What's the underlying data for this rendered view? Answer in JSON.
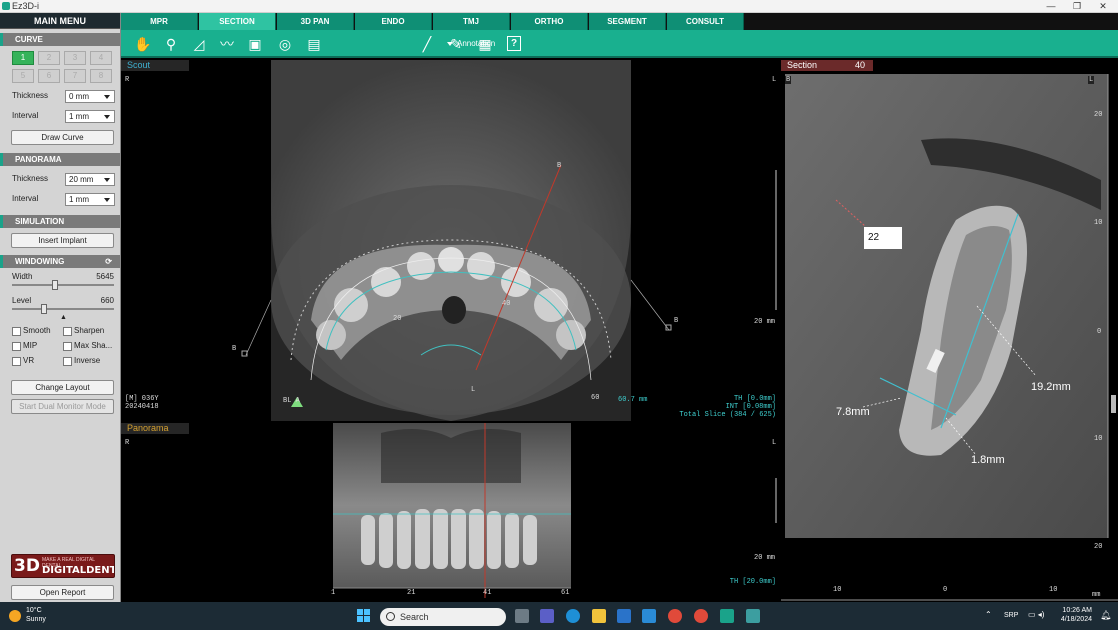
{
  "window": {
    "title": "Ez3D-i",
    "controls": [
      "—",
      "❐",
      "✕"
    ]
  },
  "sidebar": {
    "main_menu": "MAIN MENU",
    "curve": {
      "header": "CURVE",
      "numbers": [
        "1",
        "2",
        "3",
        "4",
        "5",
        "6",
        "7",
        "8"
      ],
      "thickness_label": "Thickness",
      "thickness_value": "0 mm",
      "interval_label": "Interval",
      "interval_value": "1 mm",
      "draw_curve": "Draw Curve"
    },
    "panorama": {
      "header": "PANORAMA",
      "thickness_label": "Thickness",
      "thickness_value": "20 mm",
      "interval_label": "Interval",
      "interval_value": "1 mm"
    },
    "simulation": {
      "header": "SIMULATION",
      "insert_implant": "Insert Implant"
    },
    "windowing": {
      "header": "WINDOWING",
      "width_label": "Width",
      "width_value": "5645",
      "width_fraction": 0.42,
      "level_label": "Level",
      "level_value": "660",
      "level_fraction": 0.31,
      "checks": [
        "Smooth",
        "Sharpen",
        "MIP",
        "Max Sha...",
        "VR",
        "Inverse"
      ]
    },
    "change_layout": "Change Layout",
    "dual_monitor": "Start Dual Monitor Mode",
    "logo": {
      "big": "3D",
      "small": "DIGITALDENT",
      "tiny": "MAKE A REAL DIGITAL DENTAL"
    },
    "open_report": "Open Report"
  },
  "tabs": [
    "MPR",
    "SECTION",
    "3D PAN",
    "ENDO",
    "TMJ",
    "ORTHO",
    "SEGMENT",
    "CONSULT"
  ],
  "active_tab": "SECTION",
  "toolbar": {
    "annotation": "Annotation",
    "help": "?"
  },
  "scout": {
    "title": "Scout",
    "r": "R",
    "l": "L",
    "b_labels": [
      "B",
      "B",
      "B"
    ],
    "l_bottom": "L",
    "info_left": [
      "[M] 036Y",
      "20240418"
    ],
    "info_right": [
      "TH [0.0mm]",
      "INT [0.08mm]",
      "Total Slice (384 / 625)"
    ],
    "scale": "20 mm",
    "arch_numbers": [
      "20",
      "40"
    ],
    "measure": "60.7 mm",
    "arch_labels": [
      "BL A",
      "60"
    ]
  },
  "panorama_view": {
    "title": "Panorama",
    "r": "R",
    "l": "L",
    "scale": "20 mm",
    "th": "TH [20.0mm]",
    "ruler": [
      "1",
      "21",
      "41",
      "61"
    ]
  },
  "section_view": {
    "title": "Section",
    "number": "40",
    "b": "B",
    "l": "L",
    "tag": "22",
    "measurements": [
      "19.2mm",
      "7.8mm",
      "1.8mm"
    ],
    "y_ruler": [
      "20",
      "10",
      "0",
      "10",
      "20"
    ],
    "x_ruler": [
      "10",
      "0",
      "10"
    ],
    "unit": "mm"
  },
  "taskbar": {
    "temp": "10°C",
    "weather": "Sunny",
    "search": "Search",
    "lang": "SRP",
    "time": "10:26 AM",
    "date": "4/18/2024"
  }
}
